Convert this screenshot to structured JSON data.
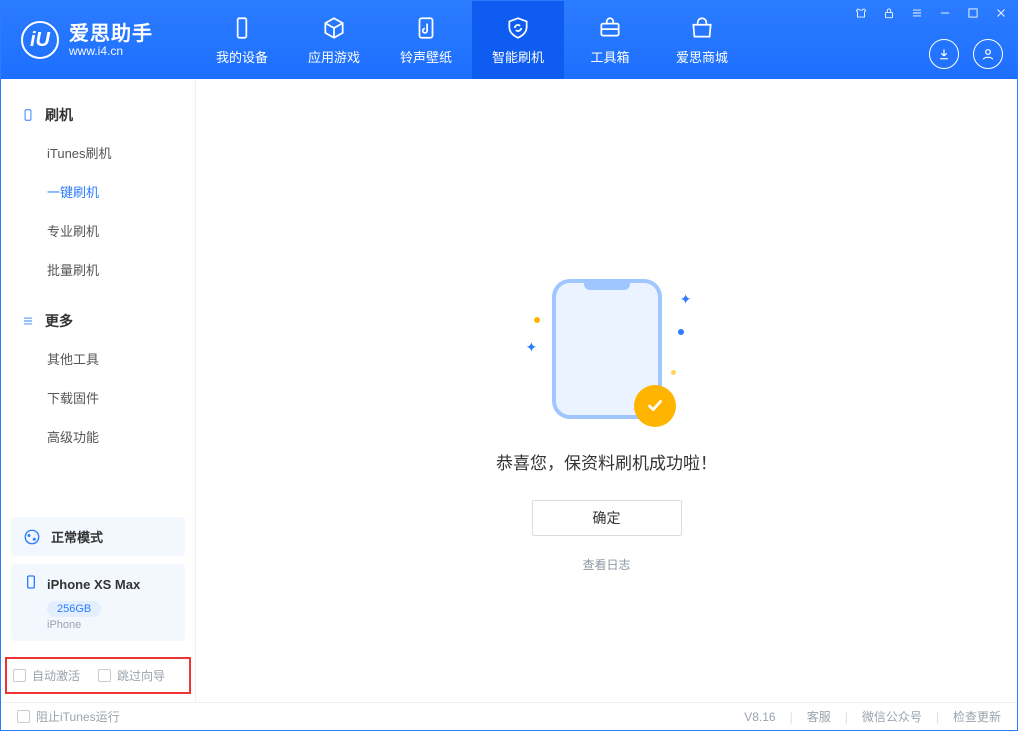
{
  "app": {
    "name": "爱思助手",
    "url": "www.i4.cn",
    "logo_letter": "iU"
  },
  "nav": {
    "items": [
      {
        "label": "我的设备",
        "icon": "device"
      },
      {
        "label": "应用游戏",
        "icon": "cube"
      },
      {
        "label": "铃声壁纸",
        "icon": "music-file"
      },
      {
        "label": "智能刷机",
        "icon": "refresh-shield",
        "active": true
      },
      {
        "label": "工具箱",
        "icon": "toolbox"
      },
      {
        "label": "爱思商城",
        "icon": "store"
      }
    ]
  },
  "header_buttons": {
    "download": "download-icon",
    "user": "user-icon"
  },
  "sidebar": {
    "groups": [
      {
        "title": "刷机",
        "icon": "phone-icon",
        "items": [
          {
            "label": "iTunes刷机"
          },
          {
            "label": "一键刷机",
            "active": true
          },
          {
            "label": "专业刷机"
          },
          {
            "label": "批量刷机"
          }
        ]
      },
      {
        "title": "更多",
        "icon": "list-icon",
        "items": [
          {
            "label": "其他工具"
          },
          {
            "label": "下载固件"
          },
          {
            "label": "高级功能"
          }
        ]
      }
    ]
  },
  "mode": {
    "label": "正常模式"
  },
  "device": {
    "name": "iPhone XS Max",
    "storage": "256GB",
    "type": "iPhone"
  },
  "options": {
    "auto_activate": "自动激活",
    "skip_guide": "跳过向导"
  },
  "main": {
    "success_message": "恭喜您，保资料刷机成功啦！",
    "confirm_button": "确定",
    "log_link": "查看日志"
  },
  "footer": {
    "block_itunes": "阻止iTunes运行",
    "version": "V8.16",
    "links": {
      "support": "客服",
      "wechat": "微信公众号",
      "update": "检查更新"
    }
  },
  "colors": {
    "brand_blue": "#2b7cff",
    "badge_orange": "#ffb400"
  }
}
